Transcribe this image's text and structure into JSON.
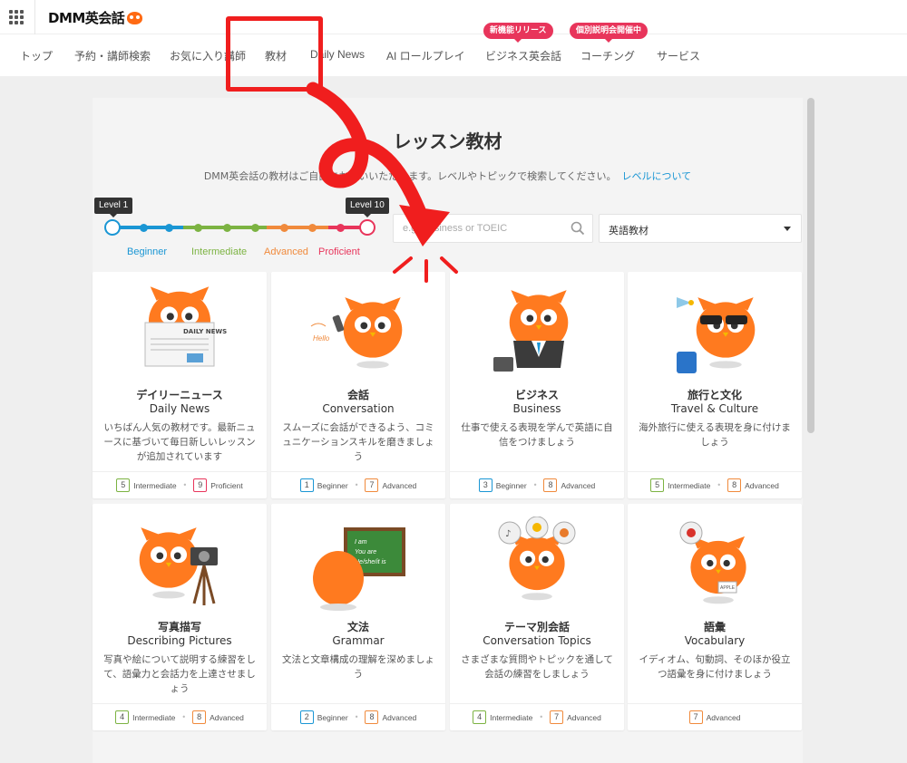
{
  "header": {
    "logo_text": "DMM英会話"
  },
  "nav": {
    "items": [
      {
        "label": "トップ"
      },
      {
        "label": "予約・講師検索"
      },
      {
        "label": "お気に入り講師"
      },
      {
        "label": "教材"
      },
      {
        "label": "Daily News"
      },
      {
        "label": "AI ロールプレイ"
      },
      {
        "label": "ビジネス英会話",
        "badge": "新機能リリース"
      },
      {
        "label": "コーチング",
        "badge": "個別説明会開催中"
      },
      {
        "label": "サービス"
      }
    ]
  },
  "main": {
    "title": "レッスン教材",
    "description": "DMM英会話の教材はご自由にお使いいただけます。レベルやトピックで検索してください。",
    "level_link": "レベルについて",
    "slider": {
      "min_tag": "Level 1",
      "max_tag": "Level 10",
      "labels": [
        "Beginner",
        "Intermediate",
        "Advanced",
        "Proficient"
      ],
      "colors": {
        "beginner": "#1a96d4",
        "intermediate": "#7cb342",
        "advanced": "#f08a3c",
        "proficient": "#e8355b"
      }
    },
    "search": {
      "placeholder": "e.g. Business or TOEIC",
      "value": ""
    },
    "category_select": {
      "value": "英語教材"
    }
  },
  "cards": [
    {
      "jp": "デイリーニュース",
      "en": "Daily News",
      "desc": "いちばん人気の教材です。最新ニュースに基づいて毎日新しいレッスンが追加されています",
      "levels": [
        {
          "n": "5",
          "label": "Intermediate"
        },
        {
          "n": "9",
          "label": "Proficient"
        }
      ],
      "icon": "owl-newspaper-icon"
    },
    {
      "jp": "会話",
      "en": "Conversation",
      "desc": "スムーズに会話ができるよう、コミュニケーションスキルを磨きましょう",
      "levels": [
        {
          "n": "1",
          "label": "Beginner"
        },
        {
          "n": "7",
          "label": "Advanced"
        }
      ],
      "icon": "owl-phone-icon",
      "icon_text": "Hello"
    },
    {
      "jp": "ビジネス",
      "en": "Business",
      "desc": "仕事で使える表現を学んで英語に自信をつけましょう",
      "levels": [
        {
          "n": "3",
          "label": "Beginner"
        },
        {
          "n": "8",
          "label": "Advanced"
        }
      ],
      "icon": "owl-business-icon"
    },
    {
      "jp": "旅行と文化",
      "en": "Travel & Culture",
      "desc": "海外旅行に使える表現を身に付けましょう",
      "levels": [
        {
          "n": "5",
          "label": "Intermediate"
        },
        {
          "n": "8",
          "label": "Advanced"
        }
      ],
      "icon": "owl-travel-icon"
    },
    {
      "jp": "写真描写",
      "en": "Describing Pictures",
      "desc": "写真や絵について説明する練習をして、語彙力と会話力を上達させましょう",
      "levels": [
        {
          "n": "4",
          "label": "Intermediate"
        },
        {
          "n": "8",
          "label": "Advanced"
        }
      ],
      "icon": "owl-camera-icon"
    },
    {
      "jp": "文法",
      "en": "Grammar",
      "desc": "文法と文章構成の理解を深めましょう",
      "levels": [
        {
          "n": "2",
          "label": "Beginner"
        },
        {
          "n": "8",
          "label": "Advanced"
        }
      ],
      "icon": "owl-blackboard-icon",
      "icon_text": "I am / You are / He/she/it is"
    },
    {
      "jp": "テーマ別会話",
      "en": "Conversation Topics",
      "desc": "さまざまな質問やトピックを通して会話の練習をしましょう",
      "levels": [
        {
          "n": "4",
          "label": "Intermediate"
        },
        {
          "n": "7",
          "label": "Advanced"
        }
      ],
      "icon": "owl-topics-icon"
    },
    {
      "jp": "語彙",
      "en": "Vocabulary",
      "desc": "イディオム、句動詞、そのほか役立つ語彙を身に付けましょう",
      "levels": [
        {
          "n": "7",
          "label": "Advanced"
        }
      ],
      "icon": "owl-vocabulary-icon",
      "icon_text": "APPLE"
    }
  ],
  "level_colors": {
    "Beginner": "#1a96d4",
    "Intermediate": "#7cb342",
    "Advanced": "#f08a3c",
    "Proficient": "#e8355b"
  },
  "annotation": {
    "color": "#f01e1e"
  }
}
